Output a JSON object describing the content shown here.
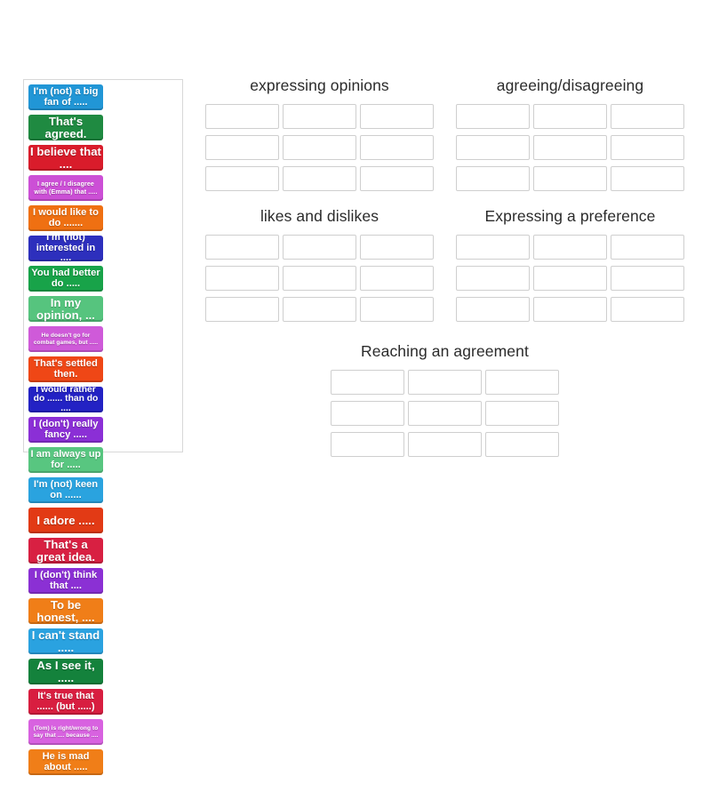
{
  "tile_bank": {
    "tiles": [
      {
        "text": "I'm (not) a big fan of .....",
        "color": "#2196d6",
        "size": "tile-t-11"
      },
      {
        "text": "That's agreed.",
        "color": "#1f8a41",
        "size": "tile-t-13"
      },
      {
        "text": "I believe that ....",
        "color": "#d91c2b",
        "size": "tile-t-13"
      },
      {
        "text": "I agree / I disagree with (Emma) that .....",
        "color": "#cc4fd6",
        "size": "tile-t-7"
      },
      {
        "text": "I would like to do .......",
        "color": "#ef7012",
        "size": "tile-t-11"
      },
      {
        "text": "I'm (not) interested in ....",
        "color": "#2d2fbd",
        "size": "tile-t-11"
      },
      {
        "text": "You had better do .....",
        "color": "#18a349",
        "size": "tile-t-11"
      },
      {
        "text": "In my opinion, ...",
        "color": "#56c47e",
        "size": "tile-t-13"
      },
      {
        "text": "He doesn't go for combat games, but .....",
        "color": "#cf5ad9",
        "size": "tile-t-6"
      },
      {
        "text": "That's settled then.",
        "color": "#ef4716",
        "size": "tile-t-11"
      },
      {
        "text": "I would rather do ...... than do ....",
        "color": "#2322c4",
        "size": "tile-t-10"
      },
      {
        "text": "I (don't) really fancy .....",
        "color": "#8b2fd6",
        "size": "tile-t-11"
      },
      {
        "text": "I am always up for .....",
        "color": "#58c680",
        "size": "tile-t-11"
      },
      {
        "text": "I'm (not) keen on ......",
        "color": "#2aa3df",
        "size": "tile-t-11"
      },
      {
        "text": "I adore .....",
        "color": "#e23a15",
        "size": "tile-t-13"
      },
      {
        "text": "That's a great idea.",
        "color": "#d82042",
        "size": "tile-t-13"
      },
      {
        "text": "I (don't) think that ....",
        "color": "#8b30d4",
        "size": "tile-t-11"
      },
      {
        "text": "To be honest, ....",
        "color": "#f07e18",
        "size": "tile-t-13"
      },
      {
        "text": "I can't stand .....",
        "color": "#2aa2e0",
        "size": "tile-t-13"
      },
      {
        "text": "As I see it, .....",
        "color": "#14823c",
        "size": "tile-t-13"
      },
      {
        "text": "It's true that ...... (but .....)",
        "color": "#d81e40",
        "size": "tile-t-11"
      },
      {
        "text": "(Tom) is right/wrong to say that .... because ....",
        "color": "#d862e0",
        "size": "tile-t-6"
      },
      {
        "text": "He is mad about .....",
        "color": "#f07e18",
        "size": "tile-t-11"
      }
    ]
  },
  "categories": [
    {
      "title": "expressing opinions",
      "slot_count": 9
    },
    {
      "title": "agreeing/disagreeing",
      "slot_count": 9
    },
    {
      "title": "likes and dislikes",
      "slot_count": 9
    },
    {
      "title": "Expressing a preference",
      "slot_count": 9
    },
    {
      "title": "Reaching an agreement",
      "slot_count": 9
    }
  ]
}
